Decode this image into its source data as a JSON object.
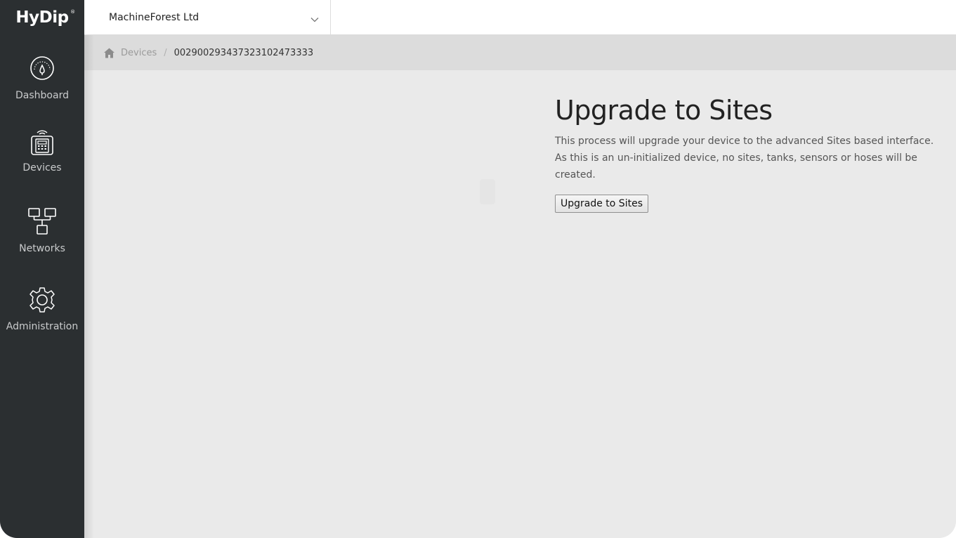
{
  "brand": {
    "name": "HyDip",
    "reg_mark": "®"
  },
  "sidebar": {
    "items": [
      {
        "label": "Dashboard",
        "icon": "gauge-icon"
      },
      {
        "label": "Devices",
        "icon": "device-wireless-icon"
      },
      {
        "label": "Networks",
        "icon": "network-icon"
      },
      {
        "label": "Administration",
        "icon": "gear-icon"
      }
    ]
  },
  "topbar": {
    "organization": "MachineForest Ltd"
  },
  "breadcrumb": {
    "home_icon": "home-icon",
    "link": "Devices",
    "separator": "/",
    "current": "002900293437323102473333"
  },
  "main": {
    "title": "Upgrade to Sites",
    "line1": "This process will upgrade your device to the advanced Sites based interface.",
    "line2": "As this is an un-initialized device, no sites, tanks, sensors or hoses will be created.",
    "button_label": "Upgrade to Sites"
  },
  "colors": {
    "sidebar_bg": "#2b2f31",
    "page_bg": "#eaeaea",
    "breadcrumb_bg": "#dcdcdc"
  }
}
